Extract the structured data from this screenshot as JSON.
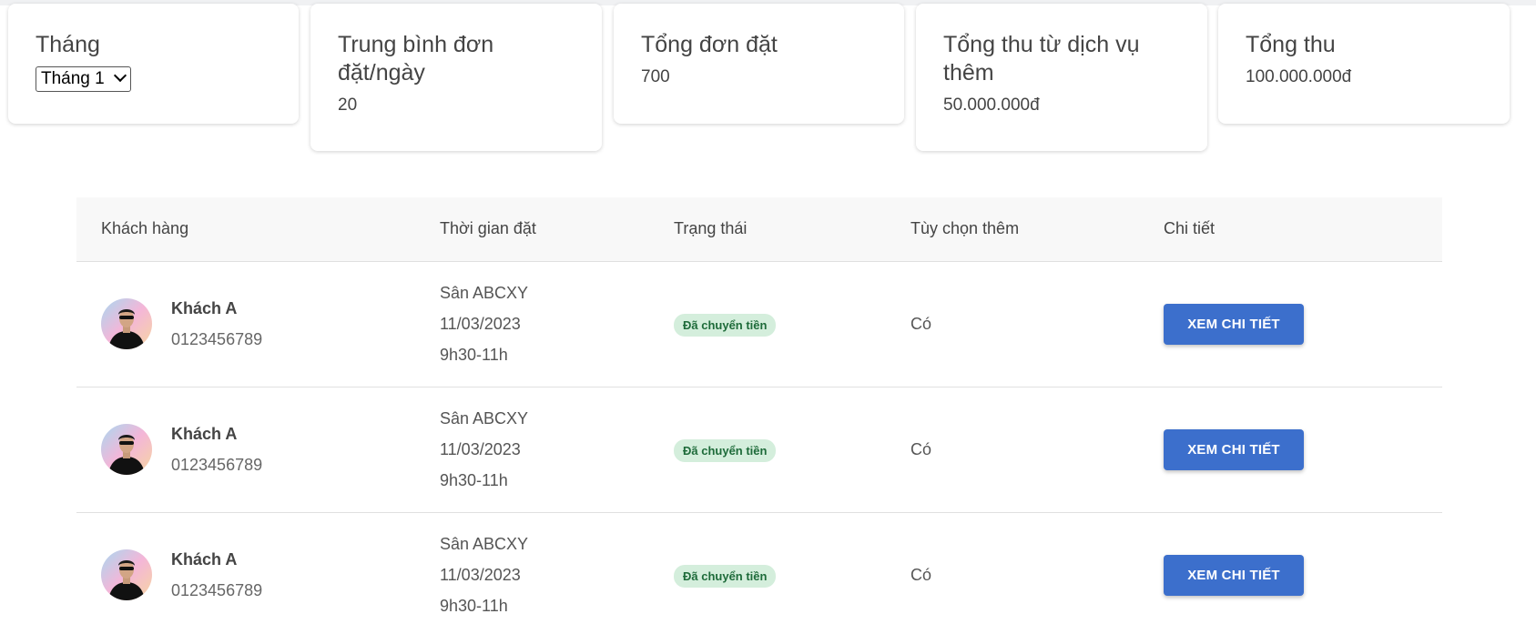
{
  "stats": {
    "month": {
      "title": "Tháng",
      "selected": "Tháng 1"
    },
    "avg_per_day": {
      "title": "Trung bình đơn đặt/ngày",
      "value": "20"
    },
    "total_orders": {
      "title": "Tổng đơn đặt",
      "value": "700"
    },
    "extra_revenue": {
      "title": "Tổng thu từ dịch vụ thêm",
      "value": "50.000.000đ"
    },
    "total_revenue": {
      "title": "Tổng thu",
      "value": "100.000.000đ"
    }
  },
  "table": {
    "headers": {
      "customer": "Khách hàng",
      "time": "Thời gian đặt",
      "status": "Trạng thái",
      "options": "Tùy chọn thêm",
      "detail": "Chi tiết"
    },
    "rows": [
      {
        "name": "Khách A",
        "phone": "0123456789",
        "venue": "Sân ABCXY",
        "date": "11/03/2023",
        "slot": "9h30-11h",
        "status": "Đã chuyển tiền",
        "option": "Có",
        "action": "XEM CHI TIẾT"
      },
      {
        "name": "Khách A",
        "phone": "0123456789",
        "venue": "Sân ABCXY",
        "date": "11/03/2023",
        "slot": "9h30-11h",
        "status": "Đã chuyển tiền",
        "option": "Có",
        "action": "XEM CHI TIẾT"
      },
      {
        "name": "Khách A",
        "phone": "0123456789",
        "venue": "Sân ABCXY",
        "date": "11/03/2023",
        "slot": "9h30-11h",
        "status": "Đã chuyển tiền",
        "option": "Có",
        "action": "XEM CHI TIẾT"
      }
    ]
  },
  "colors": {
    "button": "#3c6fcc",
    "badge_bg": "#d4eedc",
    "badge_text": "#1e6b3a"
  }
}
